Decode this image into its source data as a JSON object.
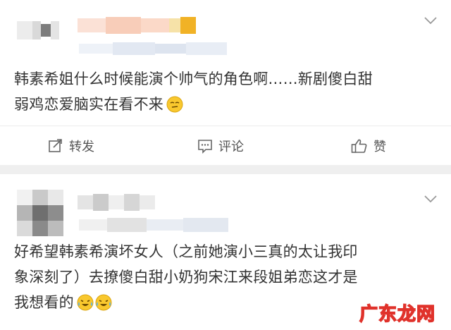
{
  "post1": {
    "body_line1": "韩素希姐什么时候能演个帅气的角色啊……新剧傻白甜",
    "body_line2": "弱鸡恋爱脑实在看不来",
    "emoji_icon": "smirk-emoji-icon",
    "actions": {
      "repost_label": "转发",
      "comment_label": "评论",
      "like_label": "赞"
    }
  },
  "post2": {
    "body_line1": "好希望韩素希演坏女人（之前她演小三真的太让我印",
    "body_line2": "象深刻了）去撩傻白甜小奶狗宋江来段姐弟恋这才是",
    "body_line3": "我想看的",
    "emoji_icon": "laugh-cry-emoji-icon"
  },
  "watermark": "广东龙网",
  "colors": {
    "accent": "#f6a623",
    "divider": "#efefef",
    "watermark": "#e0322b"
  }
}
